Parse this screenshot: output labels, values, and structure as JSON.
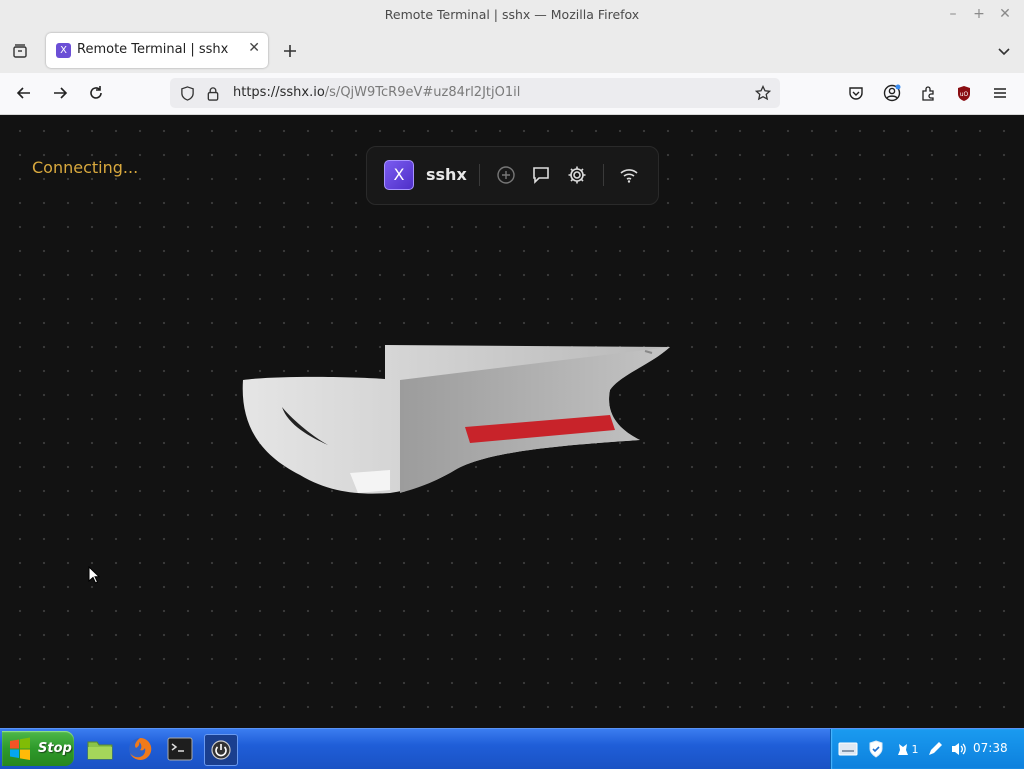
{
  "window": {
    "title": "Remote Terminal | sshx — Mozilla Firefox"
  },
  "tab": {
    "label": "Remote Terminal | sshx",
    "favicon_letter": "X"
  },
  "url": {
    "host": "https://sshx.io",
    "path": "/s/QjW9TcR9eV#uz84rl2JtjO1il"
  },
  "page": {
    "status": "Connecting...",
    "toolbar": {
      "logo_letter": "X",
      "brand": "sshx"
    },
    "accent_color": "#d9a93e"
  },
  "taskbar": {
    "start_label": "Stop",
    "tray_count": "1",
    "clock": "07:38"
  }
}
